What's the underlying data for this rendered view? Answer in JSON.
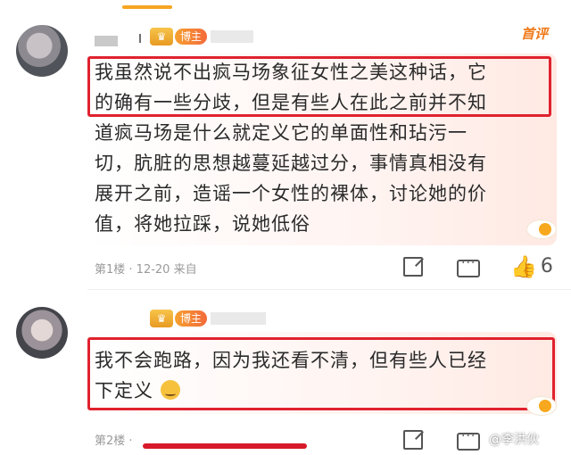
{
  "top_tab": {
    "underline_color": "#f5a623"
  },
  "comments": [
    {
      "badge": "博主",
      "crown_icon": "crown-icon",
      "top_label": "首评",
      "lines": [
        "我虽然说不出疯马场象征女性之美这种话，它",
        "的确有一些分歧，但是有些人在此之前并不知",
        "道疯马场是什么就定义它的单面性和玷污一",
        "切，肮脏的思想越蔓延越过分，事情真相没有",
        "展开之前，造谣一个女性的裸体，讨论她的价",
        "值，将她拉踩，说她低俗"
      ],
      "meta": "第1楼 · 12-20 来自",
      "likes": "6"
    },
    {
      "badge": "博主",
      "crown_icon": "crown-icon",
      "lines": [
        "我不会跑路，因为我还看不清，但有些人已经",
        "下定义"
      ],
      "meta": "第2楼 ·",
      "watermark": "@李洪伙"
    }
  ],
  "colors": {
    "frame": "#e0222e",
    "accent": "#f07a1a"
  }
}
